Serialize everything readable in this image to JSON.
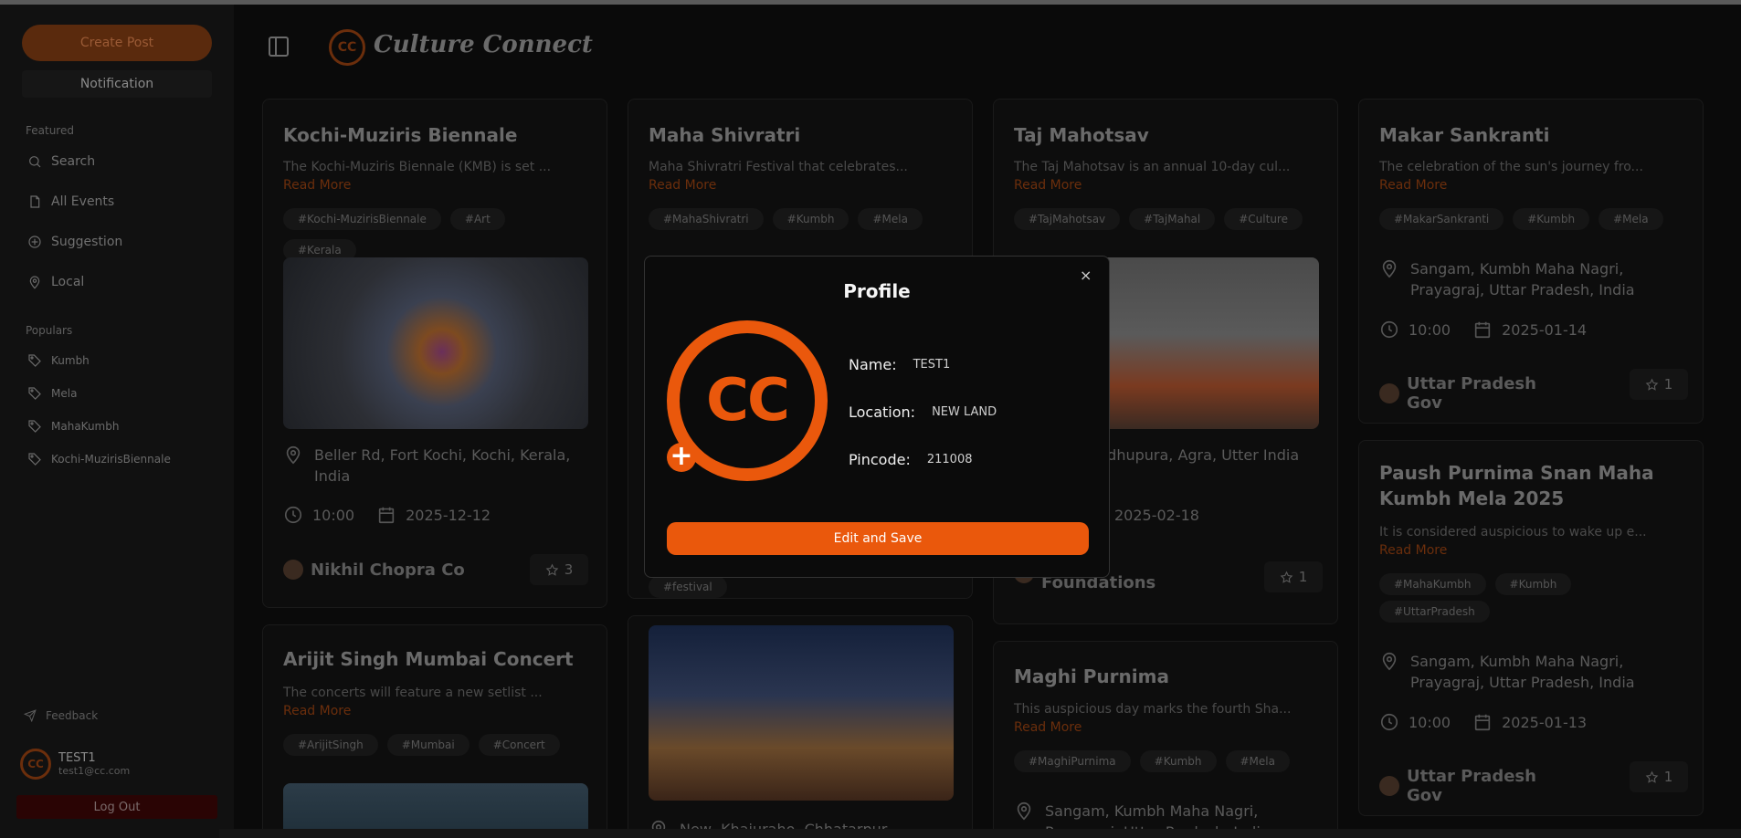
{
  "sidebar": {
    "create_post": "Create Post",
    "notification": "Notification",
    "featured_title": "Featured",
    "featured": [
      {
        "label": "Search",
        "icon": "search-icon"
      },
      {
        "label": "All Events",
        "icon": "file-icon"
      },
      {
        "label": "Suggestion",
        "icon": "suggestion-icon"
      },
      {
        "label": "Local",
        "icon": "location-pin-icon"
      }
    ],
    "populars_title": "Populars",
    "populars": [
      "Kumbh",
      "Mela",
      "MahaKumbh",
      "Kochi-MuzirisBiennale"
    ],
    "feedback": "Feedback",
    "user": {
      "name": "TEST1",
      "email": "test1@cc.com",
      "avatar_text": "CC"
    },
    "logout": "Log Out"
  },
  "header": {
    "brand": "Culture Connect",
    "logo_text": "CC"
  },
  "cards": {
    "kochi": {
      "title": "Kochi-Muziris Biennale",
      "desc": "The Kochi-Muziris Biennale (KMB) is set ...",
      "read_more": "Read More",
      "tags": [
        "#Kochi-MuzirisBiennale",
        "#Art",
        "#Kerala"
      ],
      "location": "Beller Rd, Fort Kochi, Kochi, Kerala, India",
      "time": "10:00",
      "date": "2025-12-12",
      "org": "Nikhil Chopra Co",
      "stars": "3"
    },
    "arijit": {
      "title": "Arijit Singh Mumbai Concert",
      "desc": "The concerts will feature a new setlist ...",
      "read_more": "Read More",
      "tags": [
        "#ArijitSingh",
        "#Mumbai",
        "#Concert"
      ]
    },
    "shivratri": {
      "title": "Maha Shivratri",
      "desc": "Maha Shivratri Festival that celebrates...",
      "read_more": "Read More",
      "tags": [
        "#MahaShivratri",
        "#Kumbh",
        "#Mela"
      ],
      "extra_tag": "#festival",
      "location": "New, Khajuraho, Chhatarpur, Madhya"
    },
    "taj": {
      "title": "Taj Mahotsav",
      "desc": "The Taj Mahotsav is an annual 10-day cul...",
      "read_more": "Read More",
      "tags": [
        "#TajMahotsav",
        "#TajMahal",
        "#Culture"
      ],
      "location": "m, Dhandhupura, Agra, Utter India",
      "date": "2025-02-18",
      "org": "otsav Foundations",
      "stars": "1"
    },
    "maghi": {
      "title": "Maghi Purnima",
      "desc": "This auspicious day marks the fourth Sha...",
      "read_more": "Read More",
      "tags": [
        "#MaghiPurnima",
        "#Kumbh",
        "#Mela"
      ],
      "location": "Sangam, Kumbh Maha Nagri, Prayagraj, Uttar Pradesh, India"
    },
    "makar": {
      "title": "Makar Sankranti",
      "desc": "The celebration of the sun's journey fro...",
      "read_more": "Read More",
      "tags": [
        "#MakarSankranti",
        "#Kumbh",
        "#Mela"
      ],
      "location": "Sangam, Kumbh Maha Nagri, Prayagraj, Uttar Pradesh, India",
      "time": "10:00",
      "date": "2025-01-14",
      "org": "Uttar Pradesh Gov",
      "stars": "1"
    },
    "paush": {
      "title": "Paush Purnima Snan Maha Kumbh Mela 2025",
      "desc": "It is considered auspicious to wake up e...",
      "read_more": "Read More",
      "tags": [
        "#MahaKumbh",
        "#Kumbh",
        "#UttarPradesh"
      ],
      "location": "Sangam, Kumbh Maha Nagri, Prayagraj, Uttar Pradesh, India",
      "time": "10:00",
      "date": "2025-01-13",
      "org": "Uttar Pradesh Gov",
      "stars": "1"
    }
  },
  "modal": {
    "title": "Profile",
    "close": "×",
    "avatar_text": "CC",
    "name_label": "Name:",
    "name_value": "TEST1",
    "location_label": "Location:",
    "location_value": "NEW LAND",
    "pincode_label": "Pincode:",
    "pincode_value": "211008",
    "save_button": "Edit and Save",
    "accent": "#ea580c"
  }
}
